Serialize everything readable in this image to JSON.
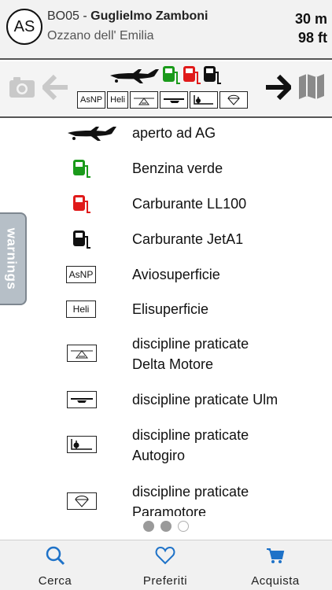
{
  "header": {
    "avatar_initials": "AS",
    "code": "BO05",
    "separator": " - ",
    "name": "Guglielmo Zamboni",
    "location": "Ozzano dell' Emilia",
    "elevation_m": "30 m",
    "elevation_ft": "98 ft"
  },
  "toolbar": {
    "badges": [
      "AsNP",
      "Heli"
    ],
    "fuel_colors": {
      "green": "#1a9a1a",
      "red": "#e01a1a",
      "black": "#111111"
    }
  },
  "warnings_label": "warnings",
  "legend": [
    {
      "icon": "airplane-icon",
      "label": "aperto ad AG"
    },
    {
      "icon": "fuel-green-icon",
      "label": "Benzina verde"
    },
    {
      "icon": "fuel-red-icon",
      "label": "Carburante LL100"
    },
    {
      "icon": "fuel-black-icon",
      "label": "Carburante JetA1"
    },
    {
      "icon": "asnp-badge-icon",
      "badge_text": "AsNP",
      "label": "Aviosuperficie"
    },
    {
      "icon": "heli-badge-icon",
      "badge_text": "Heli",
      "label": "Elisuperficie"
    },
    {
      "icon": "delta-motore-icon",
      "label": "discipline praticate",
      "label2": "Delta Motore"
    },
    {
      "icon": "ulm-icon",
      "label": "discipline praticate Ulm"
    },
    {
      "icon": "autogiro-icon",
      "label": "discipline praticate",
      "label2": "Autogiro"
    },
    {
      "icon": "paramotore-icon",
      "label": "discipline praticate",
      "label2": "Paramotore"
    }
  ],
  "pager": {
    "pages": 3,
    "current": 2
  },
  "tabs": [
    {
      "icon": "search-icon",
      "label": "Cerca"
    },
    {
      "icon": "heart-icon",
      "label": "Preferiti"
    },
    {
      "icon": "cart-icon",
      "label": "Acquista"
    }
  ],
  "accent": "#1e72c8"
}
